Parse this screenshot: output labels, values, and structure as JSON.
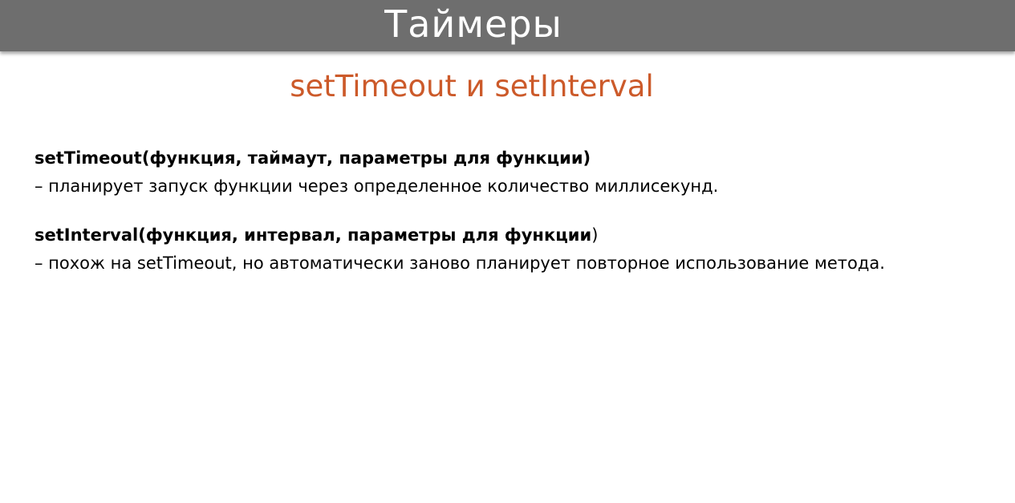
{
  "header": {
    "title": "Таймеры"
  },
  "subtitle": "setTimeout и setInterval",
  "items": [
    {
      "signature": "setTimeout(функция, таймаут, параметры для функции)",
      "signature_tail": "",
      "description": " – планирует запуск функции через определенное количество миллисекунд."
    },
    {
      "signature": "setInterval(функция, интервал, параметры для функции",
      "signature_tail": ")",
      "description": "– похож на setTimeout, но автоматически заново планирует повторное использование метода."
    }
  ],
  "colors": {
    "header_bg": "#6e6e6e",
    "header_text": "#ffffff",
    "subtitle": "#cc5a2a",
    "body_text": "#000000"
  }
}
